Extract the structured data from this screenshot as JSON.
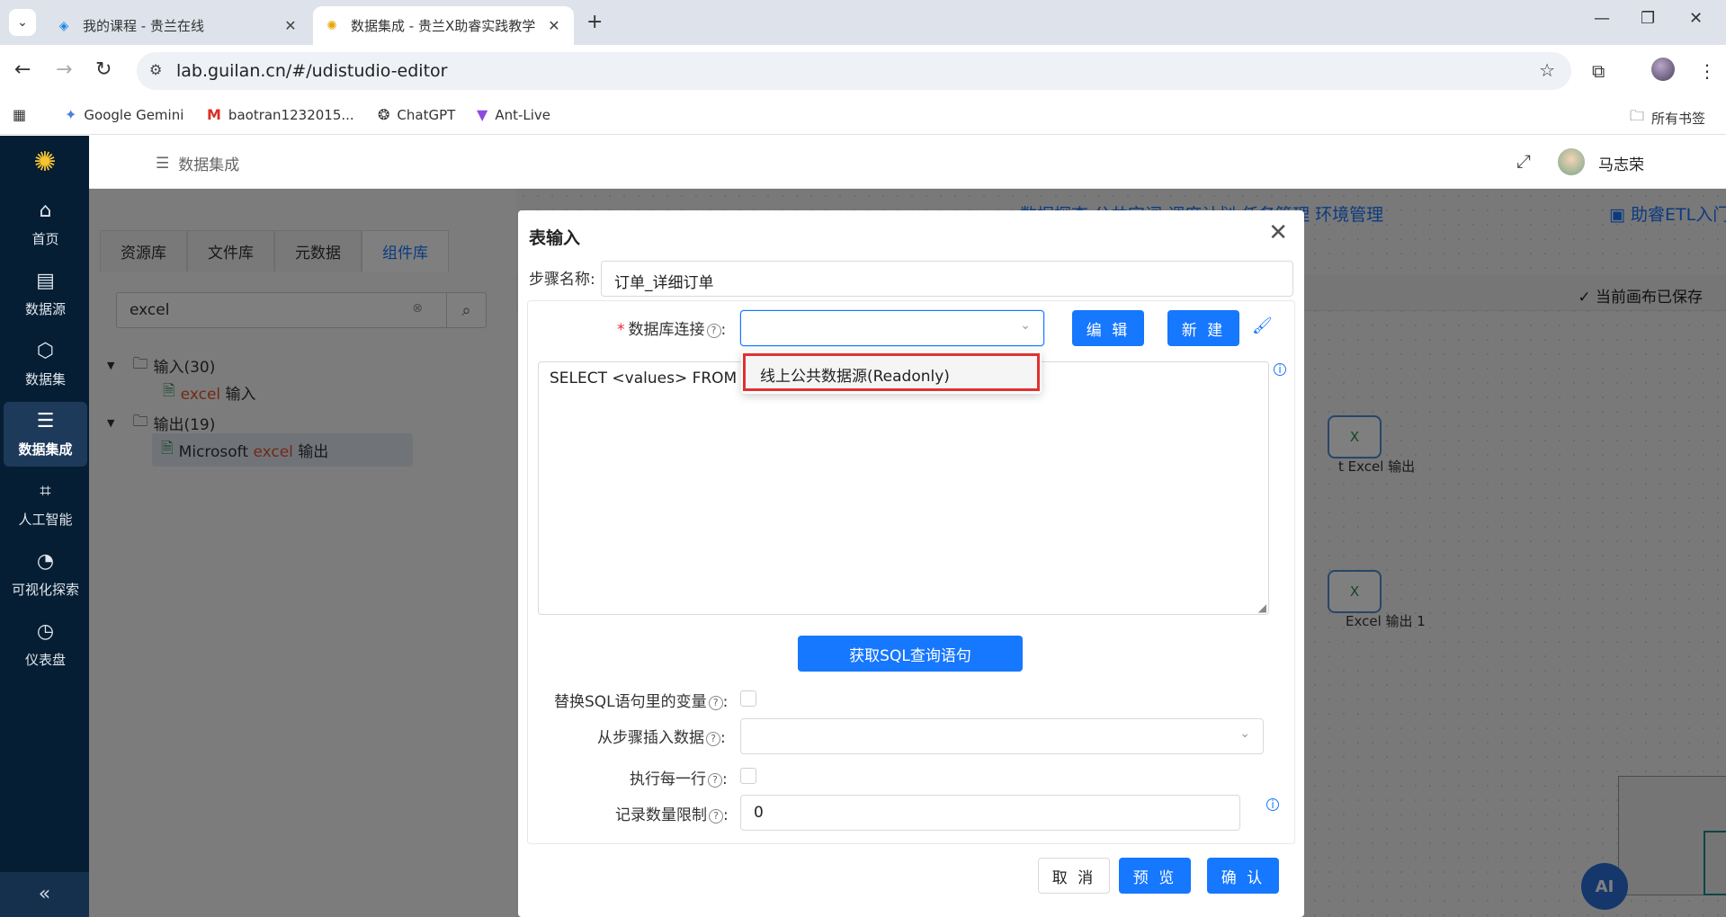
{
  "browser": {
    "tabs": [
      {
        "title": "我的课程 - 贵兰在线",
        "active": false
      },
      {
        "title": "数据集成 - 贵兰X助睿实践教学",
        "active": true
      }
    ],
    "url": "lab.guilan.cn/#/udistudio-editor",
    "bookmarks": [
      "Google Gemini",
      "baotran1232015...",
      "ChatGPT",
      "Ant-Live"
    ],
    "all_bookmarks": "所有书签"
  },
  "sidebar": {
    "items": [
      {
        "label": "首页",
        "icon": "home-icon"
      },
      {
        "label": "数据源",
        "icon": "datasource-icon"
      },
      {
        "label": "数据集",
        "icon": "cube-icon"
      },
      {
        "label": "数据集成",
        "icon": "stack-icon"
      },
      {
        "label": "人工智能",
        "icon": "ai-icon"
      },
      {
        "label": "可视化探索",
        "icon": "pie-icon"
      },
      {
        "label": "仪表盘",
        "icon": "gauge-icon"
      }
    ],
    "active_index": 3
  },
  "header": {
    "breadcrumb": "数据集成",
    "user": "马志荣"
  },
  "left_panel": {
    "tabs": [
      "资源库",
      "文件库",
      "元数据",
      "组件库"
    ],
    "active_tab": "组件库",
    "search_value": "excel",
    "tree": {
      "input_group": "输入(30)",
      "input_item_hl": "excel",
      "input_item_rest": " 输入",
      "output_group": "输出(19)",
      "output_item_pre": "Microsoft ",
      "output_item_hl": "excel",
      "output_item_rest": " 输出"
    }
  },
  "canvas": {
    "top_menu": "数据探查   公共字词   调度计划   任务管理   环境管理",
    "project": "助睿ETL入门实践 ...",
    "saved_status": "当前画布已保存",
    "node1_label": "t Excel 输出",
    "node2_label": "Excel 输出 1",
    "ai_label": "AI"
  },
  "dialog": {
    "title": "表输入",
    "step_name_label": "步骤名称:",
    "step_name_value": "订单_详细订单",
    "db_conn_label": "数据库连接",
    "db_conn_value": "",
    "edit_label": "编 辑",
    "new_label": "新 建",
    "sql_value": "SELECT <values> FROM <ta",
    "get_sql_label": "获取SQL查询语句",
    "replace_vars_label": "替换SQL语句里的变量",
    "insert_from_step_label": "从步骤插入数据",
    "exec_each_row_label": "执行每一行",
    "limit_label": "记录数量限制",
    "limit_value": "0",
    "cancel_label": "取 消",
    "preview_label": "预 览",
    "confirm_label": "确 认",
    "dropdown_options": [
      "线上公共数据源(Readonly)"
    ]
  },
  "colors": {
    "accent": "#1677ff",
    "sidebar_bg": "#061e33",
    "highlight": "#e03131"
  }
}
